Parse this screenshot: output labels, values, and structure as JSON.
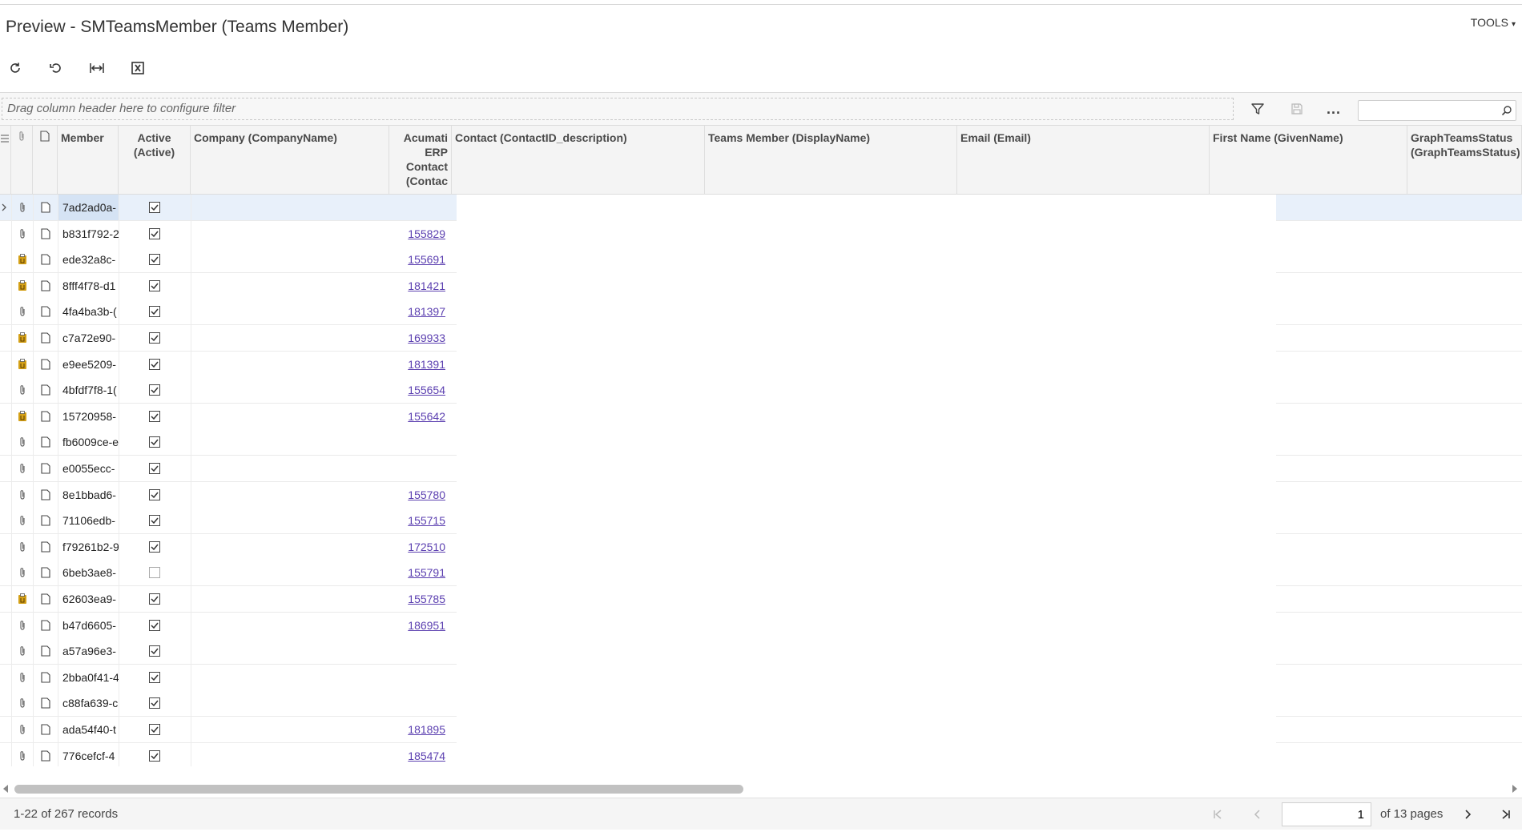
{
  "page": {
    "title": "Preview - SMTeamsMember (Teams Member)",
    "tools_label": "TOOLS"
  },
  "toolbar": {
    "buttons": [
      {
        "name": "refresh",
        "icon": "refresh-icon"
      },
      {
        "name": "undo",
        "icon": "undo-icon"
      },
      {
        "name": "fit-to-screen",
        "icon": "fit-columns-icon"
      },
      {
        "name": "export-excel",
        "icon": "excel-icon"
      }
    ]
  },
  "filter": {
    "dropzone_text": "Drag column header here to configure filter",
    "search_placeholder": "",
    "more_label": "..."
  },
  "grid": {
    "columns": [
      {
        "key": "files",
        "label": ""
      },
      {
        "key": "notes",
        "label": ""
      },
      {
        "key": "member",
        "label": "Member"
      },
      {
        "key": "active",
        "label": "Active (Active)"
      },
      {
        "key": "company",
        "label": "Company (CompanyName)"
      },
      {
        "key": "acumatica",
        "label": "Acumati ERP Contact (Contac"
      },
      {
        "key": "contact",
        "label": "Contact (ContactID_description)"
      },
      {
        "key": "teams_member",
        "label": "Teams Member (DisplayName)"
      },
      {
        "key": "email",
        "label": "Email (Email)"
      },
      {
        "key": "first_name",
        "label": "First Name (GivenName)"
      },
      {
        "key": "graph_status",
        "label": "GraphTeamsStatus (GraphTeamsStatus)"
      }
    ],
    "rows": [
      {
        "attach": "paperclip",
        "member": "7ad2ad0a-",
        "active": true,
        "contact_id": ""
      },
      {
        "attach": "paperclip",
        "member": "b831f792-2",
        "active": true,
        "contact_id": "155829"
      },
      {
        "attach": "clipboard",
        "member": "ede32a8c-",
        "active": true,
        "contact_id": "155691"
      },
      {
        "attach": "clipboard",
        "member": "8fff4f78-d1",
        "active": true,
        "contact_id": "181421"
      },
      {
        "attach": "paperclip",
        "member": "4fa4ba3b-(",
        "active": true,
        "contact_id": "181397"
      },
      {
        "attach": "clipboard",
        "member": "c7a72e90-",
        "active": true,
        "contact_id": "169933"
      },
      {
        "attach": "clipboard",
        "member": "e9ee5209-",
        "active": true,
        "contact_id": "181391"
      },
      {
        "attach": "paperclip",
        "member": "4bfdf7f8-1(",
        "active": true,
        "contact_id": "155654"
      },
      {
        "attach": "clipboard",
        "member": "15720958-",
        "active": true,
        "contact_id": "155642"
      },
      {
        "attach": "paperclip",
        "member": "fb6009ce-e",
        "active": true,
        "contact_id": ""
      },
      {
        "attach": "paperclip",
        "member": "e0055ecc-",
        "active": true,
        "contact_id": ""
      },
      {
        "attach": "paperclip",
        "member": "8e1bbad6-",
        "active": true,
        "contact_id": "155780"
      },
      {
        "attach": "paperclip",
        "member": "71106edb-",
        "active": true,
        "contact_id": "155715"
      },
      {
        "attach": "paperclip",
        "member": "f79261b2-9",
        "active": true,
        "contact_id": "172510"
      },
      {
        "attach": "paperclip",
        "member": "6beb3ae8-",
        "active": false,
        "contact_id": "155791"
      },
      {
        "attach": "clipboard",
        "member": "62603ea9-",
        "active": true,
        "contact_id": "155785"
      },
      {
        "attach": "paperclip",
        "member": "b47d6605-",
        "active": true,
        "contact_id": "186951"
      },
      {
        "attach": "paperclip",
        "member": "a57a96e3-",
        "active": true,
        "contact_id": ""
      },
      {
        "attach": "paperclip",
        "member": "2bba0f41-4",
        "active": true,
        "contact_id": ""
      },
      {
        "attach": "paperclip",
        "member": "c88fa639-c",
        "active": true,
        "contact_id": ""
      },
      {
        "attach": "paperclip",
        "member": "ada54f40-t",
        "active": true,
        "contact_id": "181895"
      },
      {
        "attach": "paperclip",
        "member": "776cefcf-4",
        "active": true,
        "contact_id": "185474"
      }
    ]
  },
  "pager": {
    "records_text": "1-22 of 267 records",
    "current_page": "1",
    "of_pages_text": "of 13 pages"
  },
  "colors": {
    "link": "#5b3fb0",
    "clipboard_icon": "#d4a017",
    "active_row": "#e8f0fa",
    "scroll_thumb": "#c1c1c1"
  }
}
